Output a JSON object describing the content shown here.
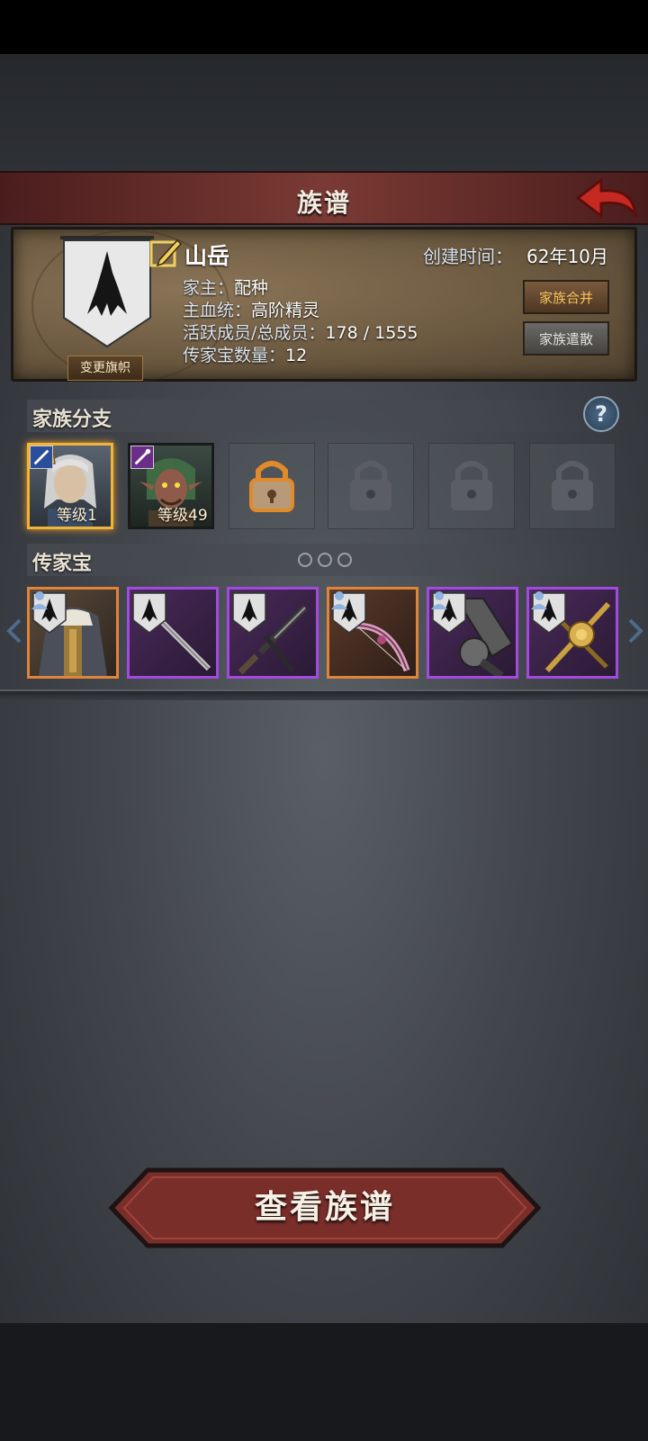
{
  "header": {
    "title": "族谱",
    "back_icon": "back-arrow-icon"
  },
  "family": {
    "name": "山岳",
    "created_label": "创建时间：",
    "created_value": "62年10月",
    "leader_label": "家主：",
    "leader_value": "配种",
    "bloodline_label": "主血统：",
    "bloodline_value": "高阶精灵",
    "members_label": "活跃成员/总成员：",
    "members_value": "178 / 1555",
    "heirloom_count_label": "传家宝数量：",
    "heirloom_count_value": "12",
    "change_banner_label": "变更旗帜",
    "merge_label": "家族合并",
    "disband_label": "家族遣散"
  },
  "branches": {
    "title": "家族分支",
    "help_icon": "?",
    "items": [
      {
        "type": "portrait",
        "level": "等级1",
        "class_icon": "sword-icon",
        "crown": true,
        "selected": true,
        "hair": "#cfcfcf",
        "skin": "#d8c0a4"
      },
      {
        "type": "portrait",
        "level": "等级49",
        "class_icon": "staff-icon",
        "crown": false,
        "selected": false,
        "hair": "#3f6a43",
        "skin": "#8f5a4a"
      },
      {
        "type": "padlock-unlockable"
      },
      {
        "type": "padlock-locked"
      },
      {
        "type": "padlock-locked"
      },
      {
        "type": "padlock-locked"
      }
    ]
  },
  "heirlooms": {
    "title": "传家宝",
    "page_count": 3,
    "items": [
      {
        "kind": "cloak",
        "rarity": "orange",
        "equipped": true
      },
      {
        "kind": "sword",
        "rarity": "purple",
        "equipped": false
      },
      {
        "kind": "dagger",
        "rarity": "purple",
        "equipped": false
      },
      {
        "kind": "bow",
        "rarity": "orange",
        "equipped": true
      },
      {
        "kind": "greatsword",
        "rarity": "purple",
        "equipped": true
      },
      {
        "kind": "golden-sword",
        "rarity": "purple",
        "equipped": true
      }
    ]
  },
  "footer": {
    "view_button_label": "查看族谱"
  },
  "colors": {
    "accent_orange": "#e0843a",
    "accent_purple": "#a24ae0",
    "title_red": "#7a3a34"
  }
}
